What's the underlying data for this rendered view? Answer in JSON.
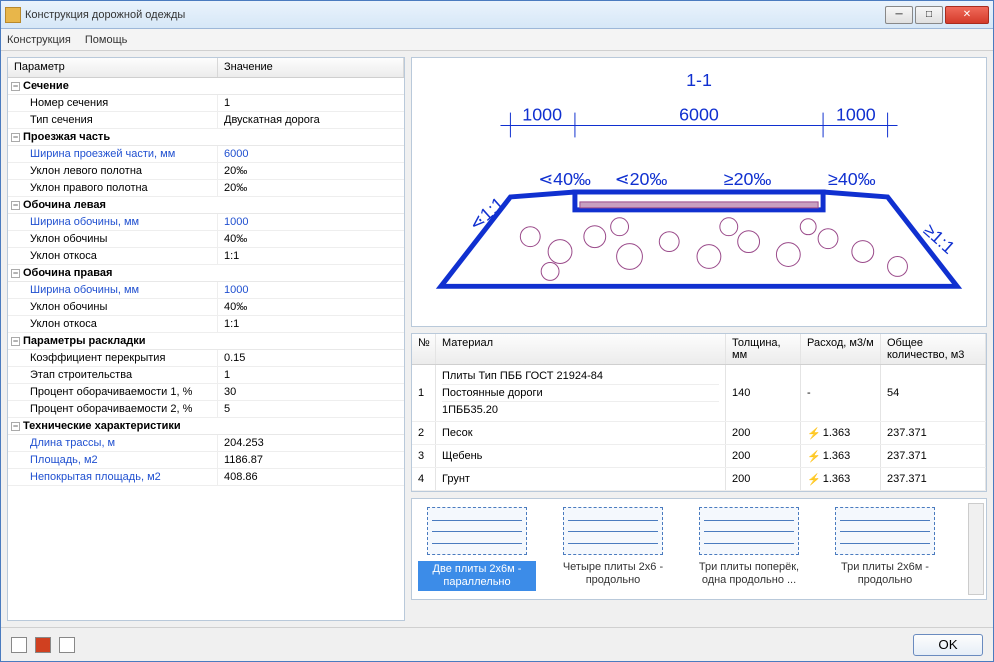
{
  "window": {
    "title": "Конструкция дорожной одежды"
  },
  "menu": {
    "items": [
      "Конструкция",
      "Помощь"
    ]
  },
  "propHeaders": {
    "param": "Параметр",
    "value": "Значение"
  },
  "groups": [
    {
      "name": "Сечение",
      "rows": [
        {
          "label": "Номер сечения",
          "value": "1"
        },
        {
          "label": "Тип сечения",
          "value": "Двускатная дорога"
        }
      ]
    },
    {
      "name": "Проезжая часть",
      "rows": [
        {
          "label": "Ширина проезжей части, мм",
          "value": "6000",
          "blue": true
        },
        {
          "label": "Уклон левого полотна",
          "value": "20‰"
        },
        {
          "label": "Уклон правого полотна",
          "value": "20‰"
        }
      ]
    },
    {
      "name": "Обочина левая",
      "rows": [
        {
          "label": "Ширина обочины, мм",
          "value": "1000",
          "blue": true
        },
        {
          "label": "Уклон обочины",
          "value": "40‰"
        },
        {
          "label": "Уклон откоса",
          "value": "1:1"
        }
      ]
    },
    {
      "name": "Обочина правая",
      "rows": [
        {
          "label": "Ширина обочины, мм",
          "value": "1000",
          "blue": true
        },
        {
          "label": "Уклон обочины",
          "value": "40‰"
        },
        {
          "label": "Уклон откоса",
          "value": "1:1"
        }
      ]
    },
    {
      "name": "Параметры раскладки",
      "rows": [
        {
          "label": "Коэффициент перекрытия",
          "value": "0.15"
        },
        {
          "label": "Этап строительства",
          "value": "1"
        },
        {
          "label": "Процент оборачиваемости 1, %",
          "value": "30"
        },
        {
          "label": "Процент оборачиваемости 2, %",
          "value": "5"
        }
      ]
    },
    {
      "name": "Технические характеристики",
      "rows": [
        {
          "label": "Длина трассы, м",
          "value": "204.253",
          "bluelabel": true
        },
        {
          "label": "Площадь, м2",
          "value": "1186.87",
          "bluelabel": true
        },
        {
          "label": "Непокрытая площадь, м2",
          "value": "408.86",
          "bluelabel": true
        }
      ]
    }
  ],
  "diagram": {
    "section_label": "1-1",
    "dims": {
      "left": "1000",
      "center": "6000",
      "right": "1000"
    },
    "slopes": {
      "l40": "⋖40‰",
      "l20": "⋖20‰",
      "r20": "≥20‰",
      "r40": "≥40‰"
    },
    "side": {
      "left": "⋖1:1",
      "right": "≥1:1"
    }
  },
  "matHeaders": {
    "n": "№",
    "mat": "Материал",
    "th": "Толщина, мм",
    "rate": "Расход, м3/м",
    "qty": "Общее количество, м3"
  },
  "materials": [
    {
      "n": "1",
      "lines": [
        "Плиты Тип ПББ ГОСТ 21924-84",
        "Постоянные дороги",
        "1ПББ35.20"
      ],
      "th": "140",
      "rate": "-",
      "qty": "54"
    },
    {
      "n": "2",
      "lines": [
        "Песок"
      ],
      "th": "200",
      "rate": "1.363",
      "qty": "237.371",
      "bolt": true
    },
    {
      "n": "3",
      "lines": [
        "Щебень"
      ],
      "th": "200",
      "rate": "1.363",
      "qty": "237.371",
      "bolt": true
    },
    {
      "n": "4",
      "lines": [
        "Грунт"
      ],
      "th": "200",
      "rate": "1.363",
      "qty": "237.371",
      "bolt": true
    }
  ],
  "patterns": [
    {
      "label": "Две плиты 2х6м - параллельно",
      "selected": true
    },
    {
      "label": "Четыре плиты 2х6 - продольно"
    },
    {
      "label": "Три плиты поперёк, одна продольно ..."
    },
    {
      "label": "Три плиты 2х6м - продольно"
    }
  ],
  "footer": {
    "ok": "OK"
  }
}
